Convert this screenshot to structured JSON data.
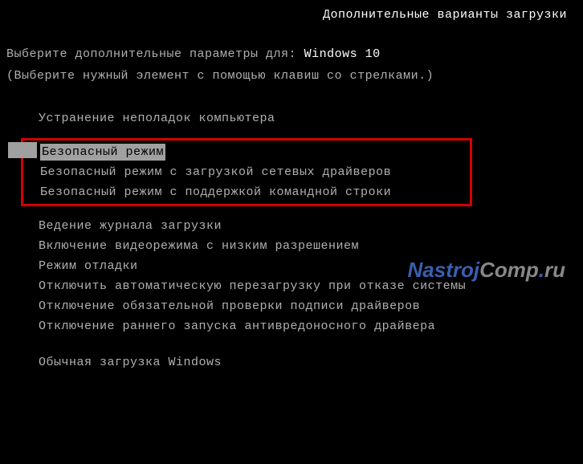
{
  "header": {
    "title": "Дополнительные варианты загрузки"
  },
  "prompt": {
    "text": "Выберите дополнительные параметры для:",
    "os": "Windows 10"
  },
  "hint": "(Выберите нужный элемент с помощью клавиш со стрелками.)",
  "menu": {
    "repair": "Устранение неполадок компьютера",
    "safe_mode": "Безопасный режим",
    "safe_mode_net": "Безопасный режим с загрузкой сетевых драйверов",
    "safe_mode_cmd": "Безопасный режим с поддержкой командной строки",
    "boot_log": "Ведение журнала загрузки",
    "low_res": "Включение видеорежима с низким разрешением",
    "debug": "Режим отладки",
    "no_auto_restart": "Отключить автоматическую перезагрузку при отказе системы",
    "disable_sig": "Отключение обязательной проверки подписи драйверов",
    "disable_elam": "Отключение раннего запуска антивредоносного драйвера",
    "normal": "Обычная загрузка Windows"
  },
  "watermark": {
    "p1": "Nastroj",
    "p2": "Comp",
    "p3": ".",
    "p4": "ru"
  }
}
